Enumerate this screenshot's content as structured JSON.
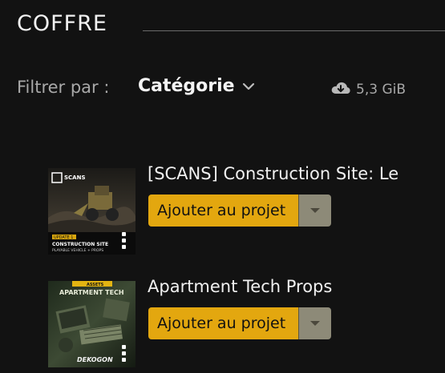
{
  "header": {
    "title": "COFFRE"
  },
  "filter": {
    "label": "Filtrer par :",
    "value": "Catégorie"
  },
  "storage": {
    "size": "5,3 GiB",
    "icon": "cloud-download-icon"
  },
  "items": [
    {
      "title": "[SCANS] Construction Site: Le",
      "button_label": "Ajouter au projet",
      "thumbnail": {
        "brand": "SCANS",
        "badge": "UPDATE 1",
        "line1": "CONSTRUCTION SITE",
        "line2": "PLAYABLE VEHICLE + PROPS"
      }
    },
    {
      "title": "Apartment Tech Props",
      "button_label": "Ajouter au projet",
      "thumbnail": {
        "badge": "ASSETS",
        "heading": "APARTMENT TECH",
        "brand": "DEKOGON"
      }
    }
  ],
  "colors": {
    "background": "#121212",
    "accent": "#e3a70f",
    "dropdown": "#8d8a78"
  }
}
